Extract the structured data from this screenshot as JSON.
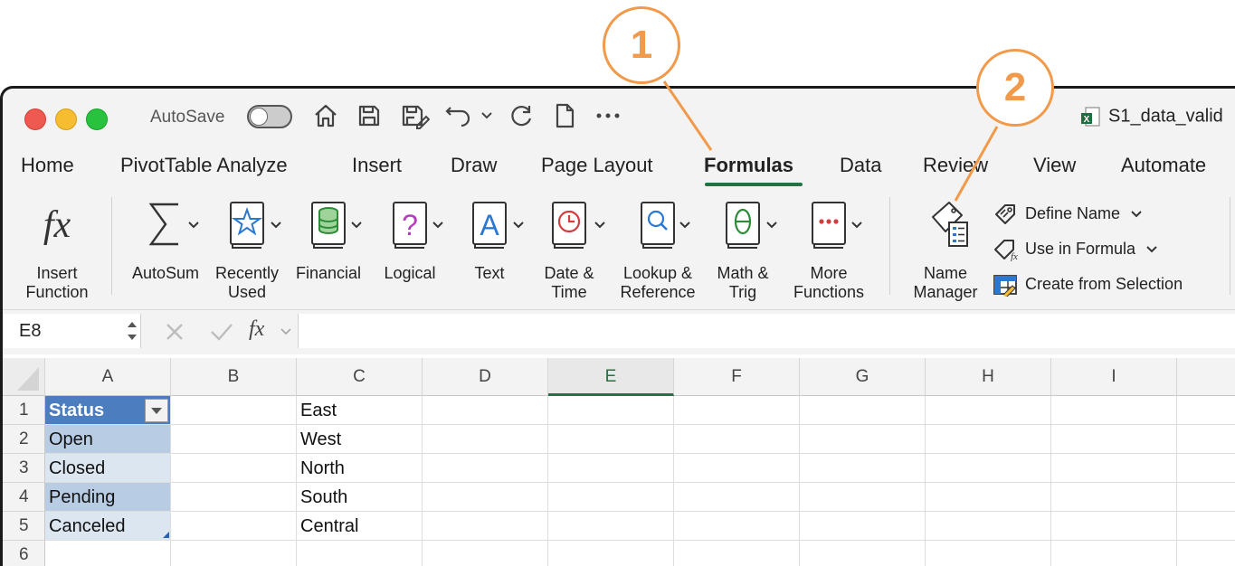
{
  "titlebar": {
    "autosave_label": "AutoSave",
    "doc_title": "S1_data_valid"
  },
  "tabs": [
    {
      "label": "Home"
    },
    {
      "label": "PivotTable Analyze"
    },
    {
      "label": "Insert"
    },
    {
      "label": "Draw"
    },
    {
      "label": "Page Layout"
    },
    {
      "label": "Formulas"
    },
    {
      "label": "Data"
    },
    {
      "label": "Review"
    },
    {
      "label": "View"
    },
    {
      "label": "Automate"
    }
  ],
  "ribbon": {
    "insert_function": "Insert\nFunction",
    "autosum": "AutoSum",
    "recently_used": "Recently\nUsed",
    "financial": "Financial",
    "logical": "Logical",
    "text": "Text",
    "date_time": "Date &\nTime",
    "lookup_reference": "Lookup &\nReference",
    "math_trig": "Math &\nTrig",
    "more_functions": "More\nFunctions",
    "name_manager": "Name\nManager",
    "define_name": "Define Name",
    "use_in_formula": "Use in Formula",
    "create_from_selection": "Create from Selection"
  },
  "formula_bar": {
    "name_box": "E8",
    "fx_label": "fx",
    "formula": ""
  },
  "columns": [
    "A",
    "B",
    "C",
    "D",
    "E",
    "F",
    "G",
    "H",
    "I"
  ],
  "rows": [
    "1",
    "2",
    "3",
    "4",
    "5",
    "6"
  ],
  "cells": {
    "A1": "Status",
    "A2": "Open",
    "A3": "Closed",
    "A4": "Pending",
    "A5": "Canceled",
    "C1": "East",
    "C2": "West",
    "C3": "North",
    "C4": "South",
    "C5": "Central"
  },
  "callouts": {
    "one": "1",
    "two": "2"
  },
  "colors": {
    "accent": "#217346",
    "callout": "#f29a4b",
    "table_header": "#4c7dbf"
  }
}
